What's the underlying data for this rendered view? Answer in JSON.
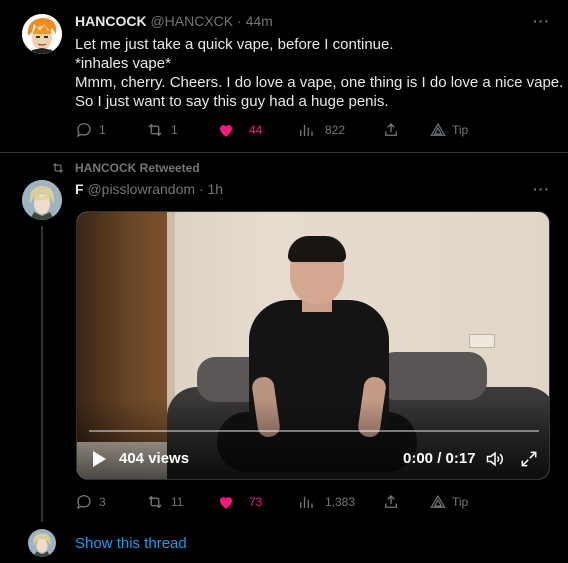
{
  "tweet1": {
    "display_name": "HANCOCK",
    "handle": "@HANCXCK",
    "separator": "·",
    "time": "44m",
    "more_label": "···",
    "lines": [
      "Let me just take a quick vape, before I continue.",
      "*inhales vape*",
      "Mmm, cherry. Cheers. I do love a vape, one thing is I do love a nice vape.",
      "So I just want to say this guy had a huge penis."
    ],
    "replies": "1",
    "retweets": "1",
    "likes": "44",
    "views": "822",
    "tip_label": "Tip"
  },
  "retweet_label": "HANCOCK Retweeted",
  "tweet2": {
    "display_name": "F",
    "handle": "@pisslowrandom",
    "separator": "·",
    "time": "1h",
    "more_label": "···",
    "video": {
      "views_label": "404 views",
      "time_label": "0:00 / 0:17",
      "progress": 0
    },
    "replies": "3",
    "retweets": "11",
    "likes": "73",
    "views": "1,383",
    "tip_label": "Tip"
  },
  "show_thread_label": "Show this thread",
  "colors": {
    "background": "#000000",
    "text": "#e7e9ea",
    "muted": "#71767b",
    "like": "#f91880",
    "link": "#1d9bf0"
  }
}
